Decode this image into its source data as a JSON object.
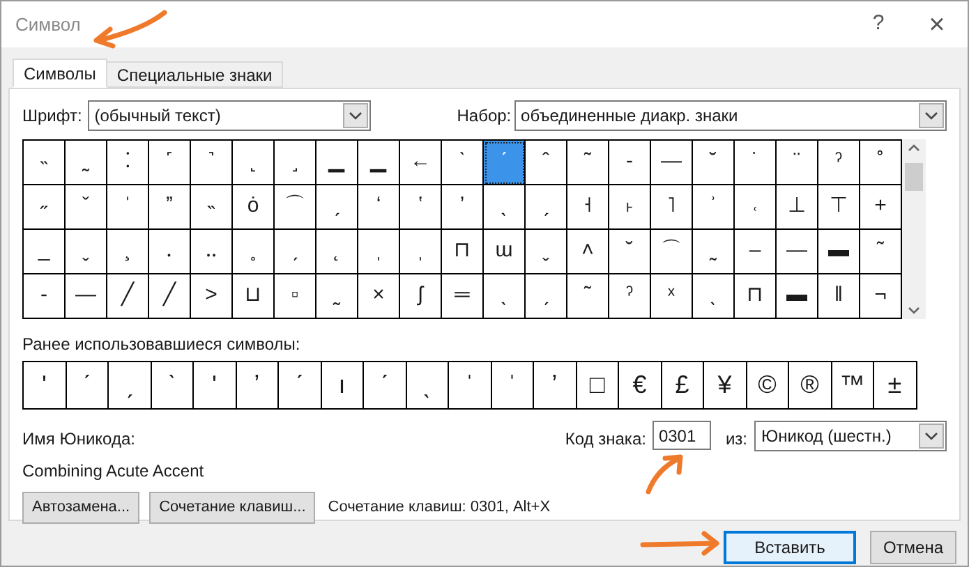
{
  "window": {
    "title": "Символ",
    "help": "?",
    "close": "×"
  },
  "tabs": [
    {
      "label": "Символы",
      "selected": true
    },
    {
      "label": "Специальные знаки",
      "selected": false
    }
  ],
  "font": {
    "label": "Шрифт:",
    "value": "(обычный текст)"
  },
  "subset": {
    "label": "Набор:",
    "value": "объединенные диакр. знаки"
  },
  "grid": [
    [
      {
        "glyph": "˵",
        "selected": false
      },
      {
        "glyph": "˷",
        "selected": false
      },
      {
        "glyph": "⁚",
        "selected": false
      },
      {
        "glyph": "˹",
        "selected": false
      },
      {
        "glyph": "˺",
        "selected": false
      },
      {
        "glyph": "˻",
        "selected": false
      },
      {
        "glyph": "˼",
        "selected": false
      },
      {
        "glyph": "▁",
        "selected": false
      },
      {
        "glyph": "▁",
        "selected": false
      },
      {
        "glyph": "←",
        "selected": false
      },
      {
        "glyph": "ˋ",
        "selected": false
      },
      {
        "glyph": "ˊ",
        "selected": true
      },
      {
        "glyph": "ˆ",
        "selected": false
      },
      {
        "glyph": "˜",
        "selected": false
      },
      {
        "glyph": "‐",
        "selected": false
      },
      {
        "glyph": "—",
        "selected": false
      },
      {
        "glyph": "˘",
        "selected": false
      },
      {
        "glyph": "˙",
        "selected": false
      },
      {
        "glyph": "¨",
        "selected": false
      },
      {
        "glyph": "ˀ",
        "selected": false
      },
      {
        "glyph": "˚",
        "selected": false
      }
    ],
    [
      {
        "glyph": "˶",
        "selected": false
      },
      {
        "glyph": "ˇ",
        "selected": false
      },
      {
        "glyph": "ˈ",
        "selected": false
      },
      {
        "glyph": "ˮ",
        "selected": false
      },
      {
        "glyph": "˵",
        "selected": false
      },
      {
        "glyph": "ȯ",
        "selected": false
      },
      {
        "glyph": "⌒",
        "selected": false
      },
      {
        "glyph": "ˏ",
        "selected": false
      },
      {
        "glyph": "ʻ",
        "selected": false
      },
      {
        "glyph": "ʽ",
        "selected": false
      },
      {
        "glyph": "ʼ",
        "selected": false
      },
      {
        "glyph": "ˎ",
        "selected": false
      },
      {
        "glyph": "ˏ",
        "selected": false
      },
      {
        "glyph": "˧",
        "selected": false
      },
      {
        "glyph": "˫",
        "selected": false
      },
      {
        "glyph": "˥",
        "selected": false
      },
      {
        "glyph": "ʾ",
        "selected": false
      },
      {
        "glyph": "˓",
        "selected": false
      },
      {
        "glyph": "⊥",
        "selected": false
      },
      {
        "glyph": "⊤",
        "selected": false
      },
      {
        "glyph": "+",
        "selected": false
      }
    ],
    [
      {
        "glyph": "_",
        "selected": false
      },
      {
        "glyph": "ˬ",
        "selected": false
      },
      {
        "glyph": "¸",
        "selected": false
      },
      {
        "glyph": "․",
        "selected": false
      },
      {
        "glyph": "‥",
        "selected": false
      },
      {
        "glyph": "˳",
        "selected": false
      },
      {
        "glyph": "ˏ",
        "selected": false
      },
      {
        "glyph": "˛",
        "selected": false
      },
      {
        "glyph": "ˌ",
        "selected": false
      },
      {
        "glyph": "ˌ",
        "selected": false
      },
      {
        "glyph": "⊓",
        "selected": false
      },
      {
        "glyph": "ɯ",
        "selected": false
      },
      {
        "glyph": "ˬ",
        "selected": false
      },
      {
        "glyph": "˄",
        "selected": false
      },
      {
        "glyph": "˘",
        "selected": false
      },
      {
        "glyph": "⌒",
        "selected": false
      },
      {
        "glyph": "˷",
        "selected": false
      },
      {
        "glyph": "–",
        "selected": false
      },
      {
        "glyph": "—",
        "selected": false
      },
      {
        "glyph": "▬",
        "selected": false
      },
      {
        "glyph": "˜",
        "selected": false
      }
    ],
    [
      {
        "glyph": "-",
        "selected": false
      },
      {
        "glyph": "—",
        "selected": false
      },
      {
        "glyph": "╱",
        "selected": false
      },
      {
        "glyph": "╱",
        "selected": false
      },
      {
        "glyph": "˃",
        "selected": false
      },
      {
        "glyph": "⊔",
        "selected": false
      },
      {
        "glyph": "▫",
        "selected": false
      },
      {
        "glyph": "˷",
        "selected": false
      },
      {
        "glyph": "×",
        "selected": false
      },
      {
        "glyph": "ʃ",
        "selected": false
      },
      {
        "glyph": "═",
        "selected": false
      },
      {
        "glyph": "ˎ",
        "selected": false
      },
      {
        "glyph": "ˏ",
        "selected": false
      },
      {
        "glyph": "˜",
        "selected": false
      },
      {
        "glyph": "ˀ",
        "selected": false
      },
      {
        "glyph": "ˣ",
        "selected": false
      },
      {
        "glyph": "ˎ",
        "selected": false
      },
      {
        "glyph": "⊓",
        "selected": false
      },
      {
        "glyph": "▬",
        "selected": false
      },
      {
        "glyph": "‖",
        "selected": false
      },
      {
        "glyph": "¬",
        "selected": false
      }
    ]
  ],
  "recent_label": "Ранее использовавшиеся символы:",
  "recent": [
    "'",
    "ˊ",
    "ˏ",
    "ˋ",
    "ʹ",
    "ʼ",
    "ˊ",
    "ı",
    "ˊ",
    "ˎ",
    "ˈ",
    "ˈ",
    "ʼ",
    "□",
    "€",
    "£",
    "¥",
    "©",
    "®",
    "™",
    "±"
  ],
  "unicode_name_label": "Имя Юникода:",
  "unicode_name": "Combining Acute Accent",
  "char_code": {
    "label": "Код знака:",
    "value": "0301"
  },
  "from": {
    "label": "из:",
    "value": "Юникод (шестн.)"
  },
  "autocorrect_button": "Автозамена...",
  "shortcut_button": "Сочетание клавиш...",
  "shortcut_text": "Сочетание клавиш: 0301, Alt+X",
  "insert_button": "Вставить",
  "cancel_button": "Отмена"
}
